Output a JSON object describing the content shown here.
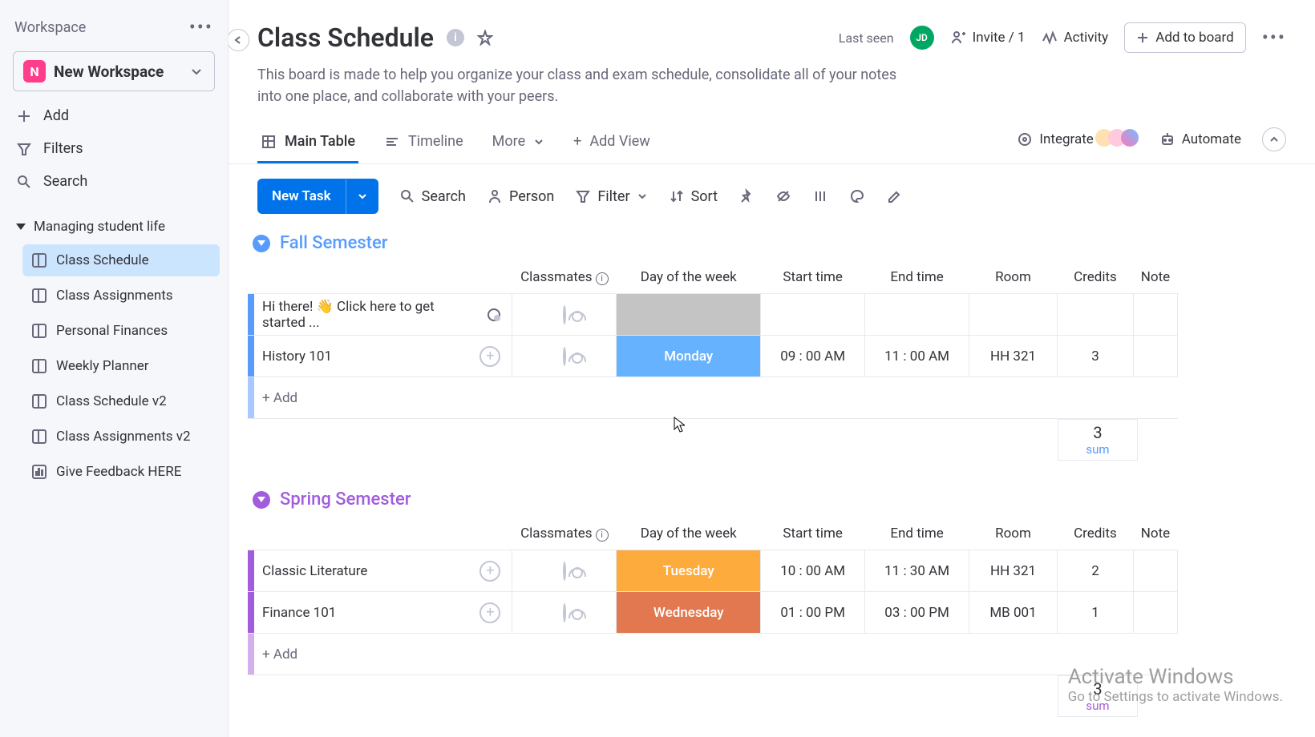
{
  "sidebar": {
    "header": "Workspace",
    "workspace_badge": "N",
    "workspace_name": "New Workspace",
    "add": "Add",
    "filters": "Filters",
    "search": "Search",
    "tree_root": "Managing student life",
    "items": [
      {
        "label": "Class Schedule",
        "active": true
      },
      {
        "label": "Class Assignments"
      },
      {
        "label": "Personal Finances"
      },
      {
        "label": "Weekly Planner"
      },
      {
        "label": "Class Schedule v2"
      },
      {
        "label": "Class Assignments v2"
      },
      {
        "label": "Give Feedback HERE",
        "chart": true
      }
    ]
  },
  "header": {
    "title": "Class Schedule",
    "last_seen": "Last seen",
    "avatar": "JD",
    "invite": "Invite / 1",
    "activity": "Activity",
    "add_to_board": "Add to board",
    "description": "This board is made to help you organize your class and exam schedule, consolidate all of your notes into one place, and collaborate with your peers."
  },
  "tabs": {
    "main_table": "Main Table",
    "timeline": "Timeline",
    "more": "More",
    "add_view": "Add View",
    "integrate": "Integrate",
    "automate": "Automate"
  },
  "toolbar": {
    "new_task": "New Task",
    "search": "Search",
    "person": "Person",
    "filter": "Filter",
    "sort": "Sort"
  },
  "columns": {
    "classmates": "Classmates",
    "day": "Day of the week",
    "start": "Start time",
    "end": "End time",
    "room": "Room",
    "credits": "Credits",
    "notes": "Note"
  },
  "groups": {
    "fall": {
      "title": "Fall Semester",
      "rows": [
        {
          "name": "Hi there! 👋 Click here to get started ...",
          "day": "",
          "start": "",
          "end": "",
          "room": "",
          "credits": "",
          "intro": true
        },
        {
          "name": "History 101",
          "day": "Monday",
          "day_class": "day-mon",
          "start": "09 : 00 AM",
          "end": "11 : 00 AM",
          "room": "HH 321",
          "credits": "3"
        }
      ],
      "add": "+ Add",
      "sum_value": "3",
      "sum_label": "sum"
    },
    "spring": {
      "title": "Spring Semester",
      "rows": [
        {
          "name": "Classic Literature",
          "day": "Tuesday",
          "day_class": "day-tue",
          "start": "10 : 00 AM",
          "end": "11 : 30 AM",
          "room": "HH 321",
          "credits": "2"
        },
        {
          "name": "Finance 101",
          "day": "Wednesday",
          "day_class": "day-wed",
          "start": "01 : 00 PM",
          "end": "03 : 00 PM",
          "room": "MB 001",
          "credits": "1"
        }
      ],
      "add": "+ Add",
      "sum_value": "3",
      "sum_label": "sum"
    }
  },
  "watermark": {
    "title": "Activate Windows",
    "sub": "Go to Settings to activate Windows."
  }
}
